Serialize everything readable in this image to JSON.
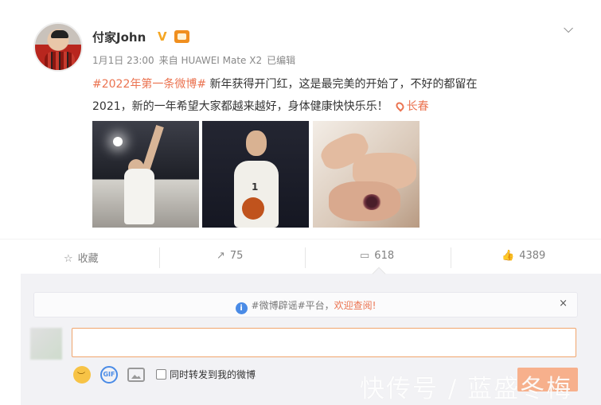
{
  "post": {
    "username": "付家John",
    "verified_mark": "V",
    "meta": {
      "date": "1月1日 23:00",
      "source": "来自 HUAWEI Mate X2",
      "edited": "已编辑"
    },
    "hashtag": "#2022年第一条微博#",
    "text_line1": " 新年获得开门红，这是最完美的开始了，不好的都留在",
    "text_line2": "2021，新的一年希望大家都越来越好，身体健康快快乐乐！",
    "location": "长春",
    "images": [
      "basketball-layup-photo",
      "player-holding-ball-photo",
      "bruised-finger-photo"
    ]
  },
  "actions": {
    "favorite_label": "收藏",
    "repost_count": "75",
    "comment_count": "618",
    "like_count": "4389"
  },
  "comment_box": {
    "notice_prefix": "#微博辟谣#平台，",
    "notice_link": "欢迎查阅!",
    "notice_close": "×",
    "input_value": "",
    "repost_checkbox_label": "同时转发到我的微博"
  },
  "watermark": "快传号 / 蓝盛冬梅",
  "icons": {
    "chevron": "chevron-down-icon",
    "favorite": "star-icon",
    "repost": "repost-icon",
    "comment": "comment-icon",
    "like": "thumbs-up-icon",
    "location": "location-pin-icon",
    "info": "info-icon",
    "emoji": "emoji-icon",
    "gif": "gif-icon",
    "image": "image-icon"
  },
  "colors": {
    "accent_orange": "#eb7350",
    "verified_gold": "#f5a623",
    "info_blue": "#4a8be6",
    "input_border": "#f0a56d"
  }
}
